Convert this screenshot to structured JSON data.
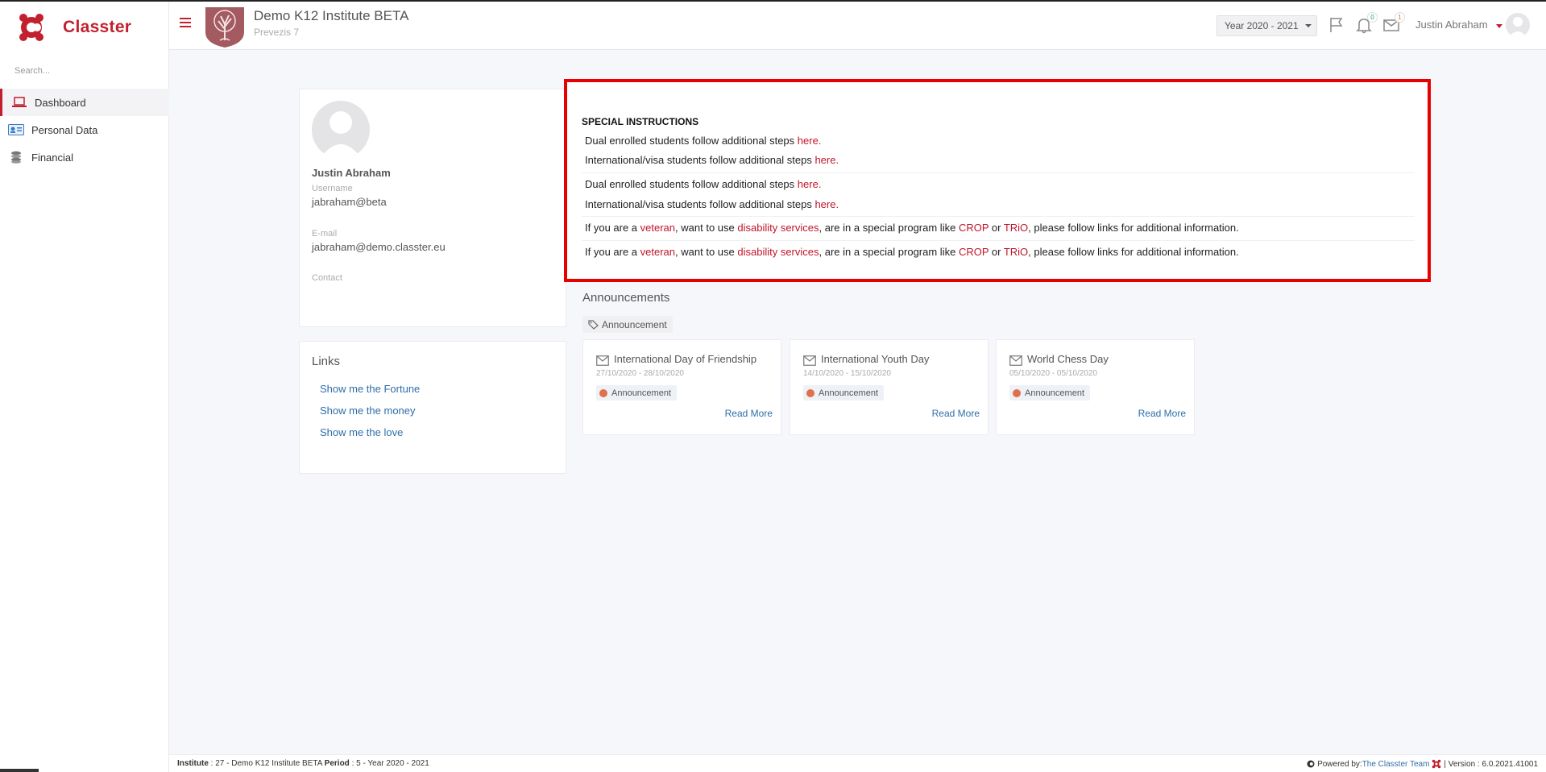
{
  "brand": {
    "name": "Classter",
    "accent": "#c2202f"
  },
  "sidebar": {
    "search_placeholder": "Search...",
    "items": [
      {
        "label": "Dashboard",
        "icon": "laptop-icon",
        "active": true
      },
      {
        "label": "Personal Data",
        "icon": "id-card-icon",
        "active": false
      },
      {
        "label": "Financial",
        "icon": "coins-icon",
        "active": false
      }
    ]
  },
  "header": {
    "institute": "Demo K12 Institute BETA",
    "subtitle": "Prevezis 7",
    "year": "Year 2020 - 2021",
    "notifications_count": "0",
    "messages_count": "1",
    "user": "Justin Abraham"
  },
  "profile": {
    "name": "Justin Abraham",
    "username_label": "Username",
    "username": "jabraham@beta",
    "email_label": "E-mail",
    "email": "jabraham@demo.classter.eu",
    "contact_label": "Contact"
  },
  "links": {
    "title": "Links",
    "items": [
      "Show me the Fortune",
      "Show me the money",
      "Show me the love"
    ]
  },
  "special": {
    "title": "SPECIAL INSTRUCTIONS",
    "dual": "Dual enrolled students follow additional steps ",
    "intl": "International/visa students follow additional steps ",
    "here": "here",
    "dot": ".",
    "v1": "If you are a ",
    "veteran": "veteran",
    "v2": ", want to use ",
    "disability": "disability services",
    "v3": ", are in a special program like ",
    "crop": "CROP",
    "or": " or ",
    "trio": "TRiO",
    "v4": ", please follow links for additional information."
  },
  "announcements": {
    "title": "Announcements",
    "tag": "Announcement",
    "read_more": "Read More",
    "items": [
      {
        "title": "International Day of Friendship",
        "date": "27/10/2020 - 28/10/2020",
        "category": "Announcement"
      },
      {
        "title": "International Youth Day",
        "date": "14/10/2020 - 15/10/2020",
        "category": "Announcement"
      },
      {
        "title": "World Chess Day",
        "date": "05/10/2020 - 05/10/2020",
        "category": "Announcement"
      }
    ]
  },
  "footer": {
    "institute_label": "Institute",
    "institute_value": " : 27 - Demo K12 Institute BETA ",
    "period_label": "Period",
    "period_value": " : 5 - Year 2020 - 2021",
    "powered_by": "Powered by: ",
    "team": "The Classter Team",
    "version": " | Version : 6.0.2021.41001"
  }
}
